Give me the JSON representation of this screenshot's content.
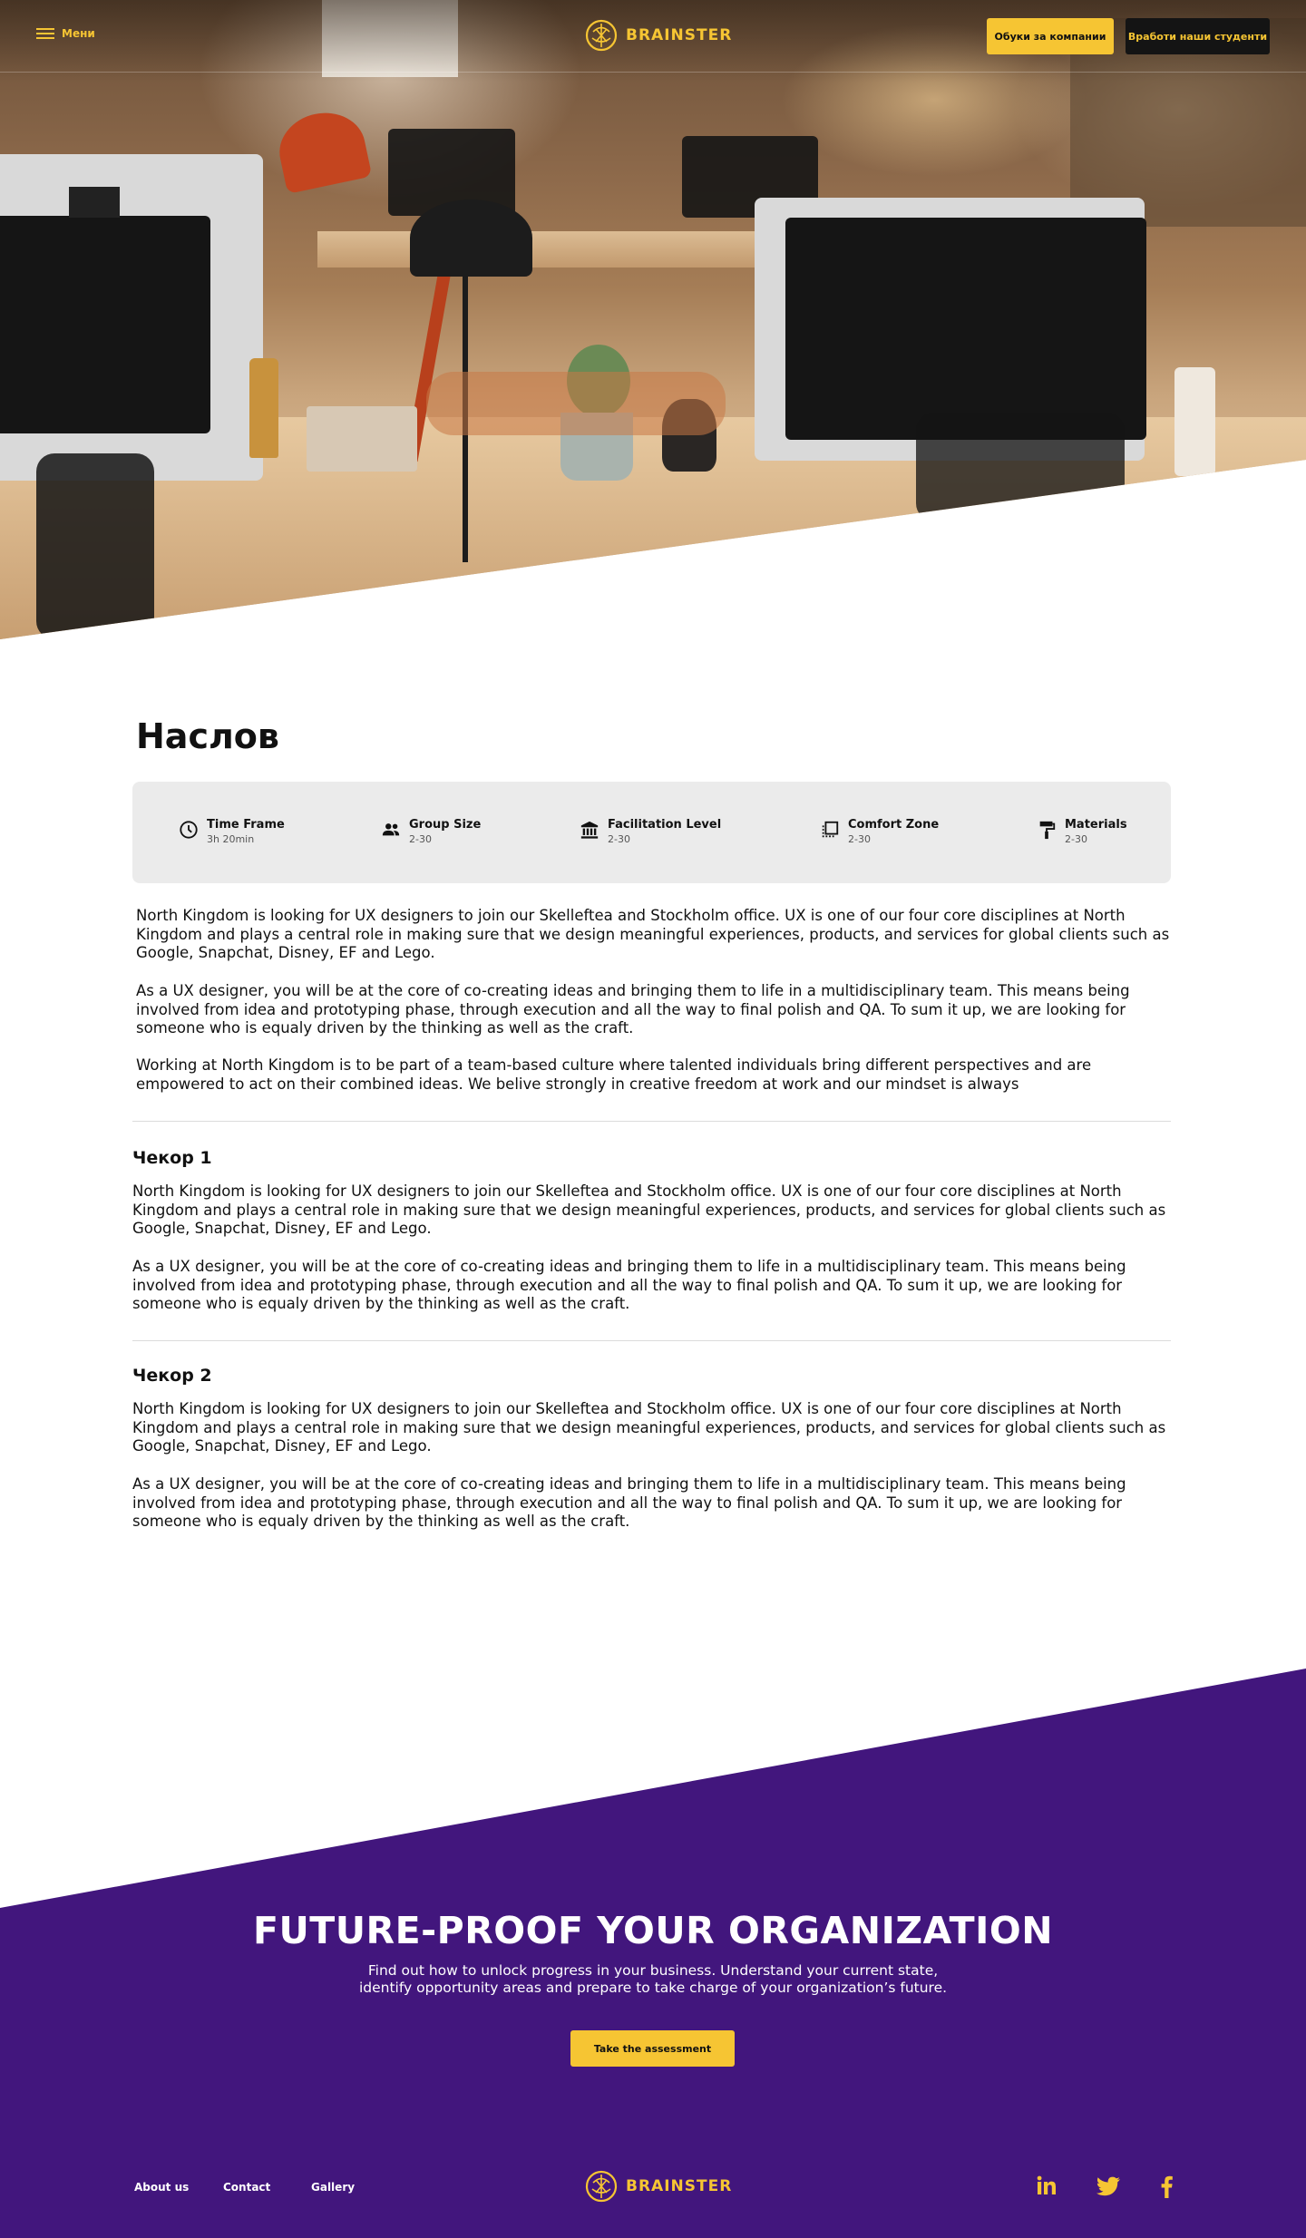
{
  "nav": {
    "menu_label": "Мени",
    "brand": "BRAINSTER",
    "btn_companies": "Обуки за компании",
    "btn_hire": "Вработи наши студенти"
  },
  "page": {
    "title": "Наслов"
  },
  "info": [
    {
      "label": "Time Frame",
      "value": "3h 20min",
      "icon": "clock-icon"
    },
    {
      "label": "Group Size",
      "value": "2-30",
      "icon": "group-icon"
    },
    {
      "label": "Facilitation Level",
      "value": "2-30",
      "icon": "bank-icon"
    },
    {
      "label": "Comfort Zone",
      "value": "2-30",
      "icon": "copy-icon"
    },
    {
      "label": "Materials",
      "value": "2-30",
      "icon": "paint-roller-icon"
    }
  ],
  "intro": {
    "p1": "North Kingdom is looking for UX designers to join our Skelleftea and Stockholm office. UX is one of our four core disciplines at North Kingdom and plays a central role in making sure that we design meaningful experiences, products, and services for global clients such as Google, Snapchat, Disney, EF and Lego.",
    "p2": "As a UX designer, you will be at the core of co-creating ideas and bringing them to life in a multidisciplinary team. This means being involved from idea and prototyping phase, through execution and all the way to final polish and QA. To sum it up, we are looking for someone who is equaly driven by the thinking as well as the craft.",
    "p3": "Working at North Kingdom is to be part of a team-based culture where talented individuals bring different perspectives and are empowered to act on their combined ideas. We belive strongly in creative freedom at work and our mindset is always"
  },
  "steps": [
    {
      "heading": "Чекор 1",
      "p1": "North Kingdom is looking for UX designers to join our Skelleftea and Stockholm office. UX is one of our four core disciplines at North Kingdom and plays a central role in making sure that we design meaningful experiences, products, and services for global clients such as Google, Snapchat, Disney, EF and Lego.",
      "p2": "As a UX designer, you will be at the core of co-creating ideas and bringing them to life in a multidisciplinary team. This means being involved from idea and prototyping phase, through execution and all the way to final polish and QA. To sum it up, we are looking for someone who is equaly driven by the thinking as well as the craft."
    },
    {
      "heading": "Чекор 2",
      "p1": "North Kingdom is looking for UX designers to join our Skelleftea and Stockholm office. UX is one of our four core disciplines at North Kingdom and plays a central role in making sure that we design meaningful experiences, products, and services for global clients such as Google, Snapchat, Disney, EF and Lego.",
      "p2": "As a UX designer, you will be at the core of co-creating ideas and bringing them to life in a multidisciplinary team. This means being involved from idea and prototyping phase, through execution and all the way to final polish and QA. To sum it up, we are looking for someone who is equaly driven by the thinking as well as the craft."
    }
  ],
  "cta": {
    "title": "FUTURE-PROOF YOUR ORGANIZATION",
    "text": "Find out how to unlock progress in your business. Understand your current state, identify opportunity areas and prepare to take charge of your organization’s future.",
    "button": "Take the assessment"
  },
  "footer": {
    "links": [
      "About us",
      "Contact",
      "Gallery"
    ],
    "brand": "BRAINSTER",
    "social": [
      "linkedin-icon",
      "twitter-icon",
      "facebook-icon"
    ]
  },
  "colors": {
    "accent": "#f6c533",
    "purple": "#42167d",
    "info_bg": "#ebebeb"
  }
}
